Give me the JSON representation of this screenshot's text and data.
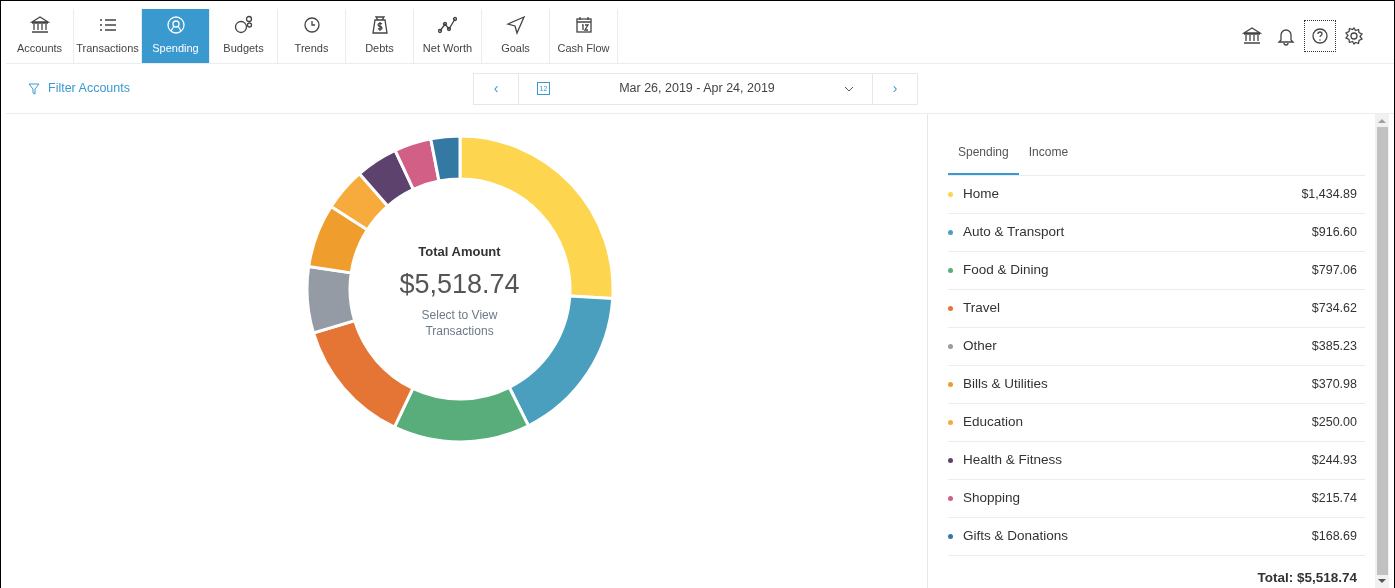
{
  "nav_tabs": [
    {
      "label": "Accounts",
      "selected": false
    },
    {
      "label": "Transactions",
      "selected": false
    },
    {
      "label": "Spending",
      "selected": true
    },
    {
      "label": "Budgets",
      "selected": false
    },
    {
      "label": "Trends",
      "selected": false
    },
    {
      "label": "Debts",
      "selected": false
    },
    {
      "label": "Net Worth",
      "selected": false
    },
    {
      "label": "Goals",
      "selected": false
    },
    {
      "label": "Cash Flow",
      "selected": false
    }
  ],
  "filter": {
    "label": "Filter Accounts"
  },
  "date_range": {
    "prev": "‹",
    "calendar_day": "12",
    "label": "Mar 26, 2019 - Apr 24, 2019",
    "next": "›"
  },
  "chart": {
    "title": "Total Amount",
    "total": "$5,518.74",
    "hint": "Select to View Transactions",
    "chart_data": {
      "type": "donut",
      "categories": [
        "Home",
        "Auto & Transport",
        "Food & Dining",
        "Travel",
        "Other",
        "Bills & Utilities",
        "Education",
        "Health & Fitness",
        "Shopping",
        "Gifts & Donations"
      ],
      "values": [
        26.0,
        16.61,
        14.44,
        13.31,
        6.98,
        6.72,
        4.53,
        4.44,
        3.91,
        3.06
      ]
    }
  },
  "side_tabs": [
    {
      "label": "Spending",
      "selected": true
    },
    {
      "label": "Income",
      "selected": false
    }
  ],
  "categories": [
    {
      "amount": "$1,434.89",
      "color": "#fdd54e"
    },
    {
      "amount": "$916.60",
      "color": "#4a9fbf"
    },
    {
      "amount": "$797.06",
      "color": "#58ad7b"
    },
    {
      "amount": "$734.62",
      "color": "#e47535"
    },
    {
      "amount": "$385.23",
      "color": "#959ba4"
    },
    {
      "amount": "$370.98",
      "color": "#ef9e2e"
    },
    {
      "amount": "$250.00",
      "color": "#f7ab3c"
    },
    {
      "amount": "$244.93",
      "color": "#5d426d"
    },
    {
      "amount": "$215.74",
      "color": "#d15f86"
    },
    {
      "amount": "$168.69",
      "color": "#3479a3"
    }
  ],
  "total": "Total: $5,518.74"
}
